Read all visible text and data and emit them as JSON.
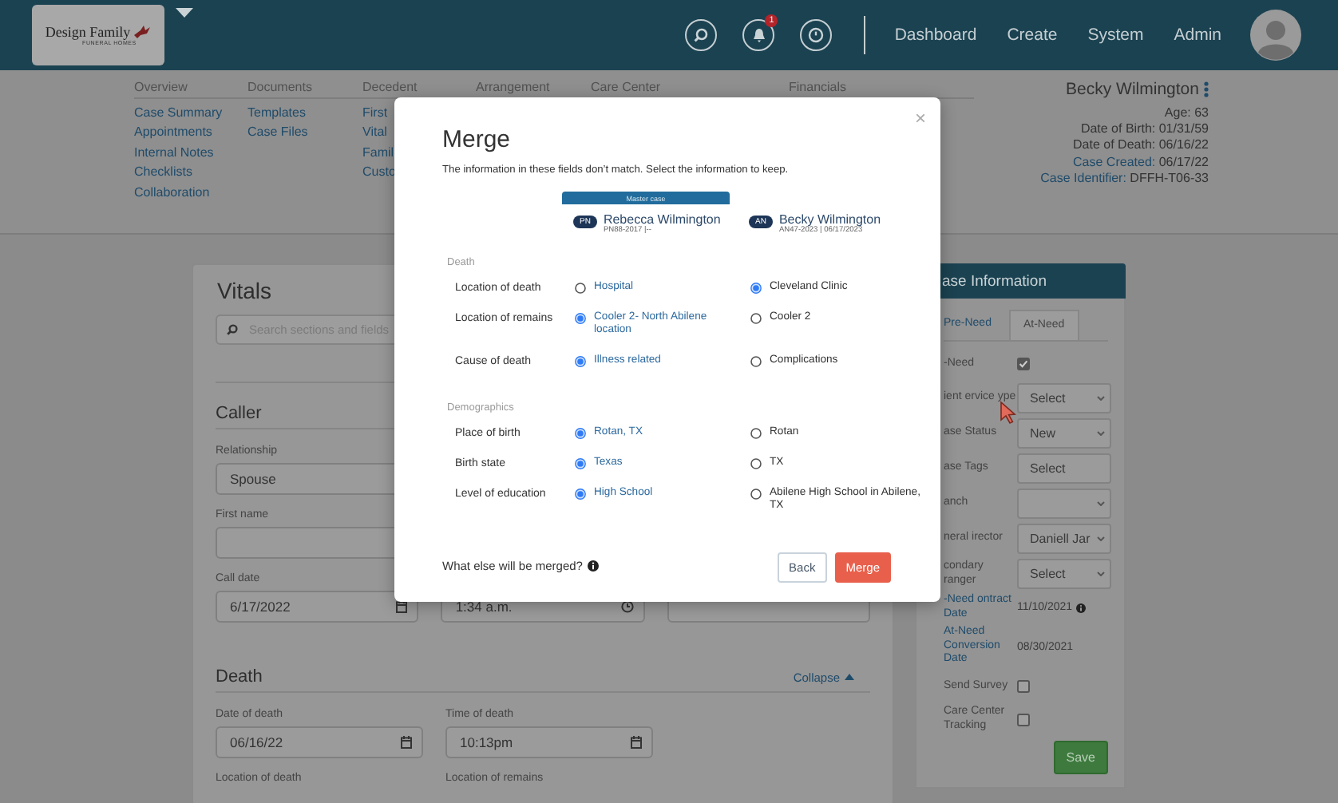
{
  "header": {
    "logo": {
      "title": "Design Family",
      "subtitle": "FUNERAL HOMES"
    },
    "notification_count": "1",
    "nav_links": [
      "Dashboard",
      "Create",
      "System",
      "Admin"
    ]
  },
  "case_nav": [
    {
      "heading": "Overview",
      "links": [
        "Case Summary",
        "Appointments",
        "Internal Notes",
        "Checklists",
        "Collaboration"
      ]
    },
    {
      "heading": "Documents",
      "links": [
        "Templates",
        "Case Files"
      ]
    },
    {
      "heading": "Decedent",
      "links": [
        "First",
        "Vital",
        "Famil",
        "Custo"
      ]
    },
    {
      "heading": "Arrangement"
    },
    {
      "heading": "Care Center"
    },
    {
      "heading": "Financials"
    }
  ],
  "case_summary": {
    "name": "Becky Wilmington",
    "details": [
      {
        "label": "Age:",
        "value": "63",
        "kind": "plain"
      },
      {
        "label": "Date of Birth:",
        "value": "01/31/59",
        "kind": "plain"
      },
      {
        "label": "Date of Death:",
        "value": "06/16/22",
        "kind": "plain"
      },
      {
        "label": "Case Created:",
        "value": "06/17/22",
        "kind": "link"
      },
      {
        "label": "Case Identifier:",
        "value": "DFFH-T06-33",
        "kind": "link"
      }
    ]
  },
  "vitals": {
    "title": "Vitals",
    "search": {
      "placeholder": "Search sections and fields"
    },
    "sections": [
      {
        "title": "Caller",
        "rows": [
          [
            {
              "label": "Relationship",
              "value": "Spouse",
              "kind": "text"
            }
          ],
          [
            {
              "label": "First name",
              "kind": "text"
            }
          ],
          [
            {
              "label": "Call date",
              "value": "6/17/2022",
              "kind": "date"
            },
            {
              "value": "1:34 a.m.",
              "kind": "time"
            },
            {
              "kind": "text"
            }
          ]
        ]
      },
      {
        "title": "Death",
        "action": "Collapse",
        "rows": [
          [
            {
              "label": "Date of death",
              "value": "06/16/22",
              "kind": "date"
            },
            {
              "label": "Time of death",
              "value": "10:13pm",
              "kind": "date"
            }
          ],
          [
            {
              "label": "Location of death",
              "kind": "label"
            },
            {
              "label": "Location of remains",
              "kind": "label"
            }
          ]
        ]
      }
    ]
  },
  "case_info": {
    "title": "ase Information",
    "tabs": [
      {
        "label": "Pre-Need",
        "selected": false
      },
      {
        "label": "At-Need",
        "selected": true
      }
    ],
    "rows": [
      {
        "label": "-Need",
        "kind": "checkbox",
        "checked": true,
        "link": false
      },
      {
        "label": "ient ervice ype",
        "kind": "select",
        "value": "Select",
        "link": false
      },
      {
        "label": "ase Status",
        "kind": "select",
        "value": "New",
        "link": false
      },
      {
        "label": "ase Tags",
        "kind": "button",
        "value": "Select",
        "link": false
      },
      {
        "label": "anch",
        "kind": "select",
        "link": false
      },
      {
        "label": "neral irector",
        "kind": "select",
        "value": "Daniell Jar",
        "link": false
      },
      {
        "label": "condary ranger",
        "kind": "select",
        "value": "Select",
        "link": false
      },
      {
        "label": "-Need ontract Date",
        "kind": "date",
        "value": "11/10/2021",
        "info": true,
        "link": true
      },
      {
        "label": "At-Need Conversion Date",
        "kind": "date",
        "value": "08/30/2021",
        "info": false,
        "link": true
      },
      {
        "label": "Send Survey",
        "kind": "checkbox",
        "checked": false,
        "link": false
      },
      {
        "label": "Care Center Tracking",
        "kind": "checkbox",
        "checked": false,
        "link": false
      }
    ],
    "save": "Save"
  },
  "merge_dialog": {
    "close_label": "×",
    "title": "Merge",
    "message": "The information in these fields don’t match. Select the information to keep.",
    "master_label": "Master case",
    "cases": [
      {
        "badge": "PN",
        "name": "Rebecca Wilmington",
        "meta": "PN88-2017 |--"
      },
      {
        "badge": "AN",
        "name": "Becky Wilmington",
        "meta": "AN47-2023 | 06/17/2023"
      }
    ],
    "groups": [
      {
        "title": "Death",
        "fields": [
          {
            "label": "Location of death",
            "options": [
              {
                "text": "Hospital",
                "selected": false
              },
              {
                "text": "Cleveland Clinic",
                "selected": true
              }
            ]
          },
          {
            "label": "Location of remains",
            "options": [
              {
                "text": "Cooler 2- North Abilene location",
                "selected": true
              },
              {
                "text": "Cooler 2",
                "selected": false
              }
            ]
          },
          {
            "label": "Cause of death",
            "options": [
              {
                "text": "Illness related",
                "selected": true
              },
              {
                "text": "Complications",
                "selected": false
              }
            ]
          }
        ]
      },
      {
        "title": "Demographics",
        "fields": [
          {
            "label": "Place of birth",
            "options": [
              {
                "text": "Rotan, TX",
                "selected": true
              },
              {
                "text": "Rotan",
                "selected": false
              }
            ]
          },
          {
            "label": "Birth state",
            "options": [
              {
                "text": "Texas",
                "selected": true
              },
              {
                "text": "TX",
                "selected": false
              }
            ]
          },
          {
            "label": "Level of education",
            "options": [
              {
                "text": "High School",
                "selected": true
              },
              {
                "text": "Abilene High School in Abilene, TX",
                "selected": false
              }
            ]
          }
        ]
      }
    ],
    "more": "What else will be merged?",
    "buttons": [
      {
        "label": "Back",
        "kind": "secondary"
      },
      {
        "label": "Merge",
        "kind": "primary"
      }
    ]
  }
}
